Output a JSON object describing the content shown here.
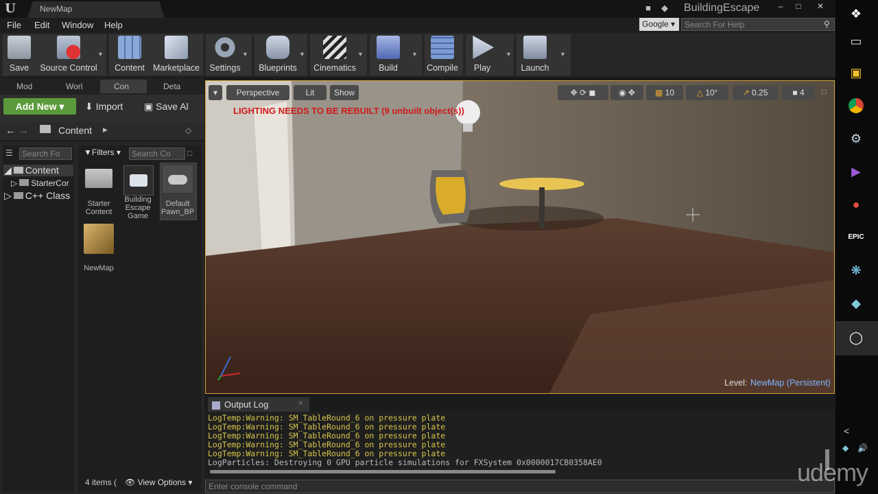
{
  "window": {
    "tab_title": "NewMap",
    "project_name": "BuildingEscape",
    "logo_glyph": "U"
  },
  "menu": [
    "File",
    "Edit",
    "Window",
    "Help"
  ],
  "search": {
    "engine": "Google",
    "placeholder": "Search For Help"
  },
  "toolbar": [
    {
      "label": "Save",
      "icon": "save-icon"
    },
    {
      "label": "Source Control",
      "icon": "source-control-icon"
    },
    {
      "label": "Content",
      "icon": "content-icon"
    },
    {
      "label": "Marketplace",
      "icon": "marketplace-icon"
    },
    {
      "label": "Settings",
      "icon": "settings-icon"
    },
    {
      "label": "Blueprints",
      "icon": "blueprints-icon"
    },
    {
      "label": "Cinematics",
      "icon": "cinematics-icon"
    },
    {
      "label": "Build",
      "icon": "build-icon"
    },
    {
      "label": "Compile",
      "icon": "compile-icon"
    },
    {
      "label": "Play",
      "icon": "play-icon"
    },
    {
      "label": "Launch",
      "icon": "launch-icon"
    }
  ],
  "panel_tabs": [
    "Mod",
    "Worl",
    "Con",
    "Deta"
  ],
  "content_browser": {
    "add_new": "Add New",
    "import": "Import",
    "save_all": "Save Al",
    "crumb": "Content",
    "tree_search": "Search Fo",
    "filters": "Filters",
    "asset_search": "Search Co",
    "tree": [
      "Content",
      "StarterCor",
      "C++ Class"
    ],
    "assets": [
      "Starter Content",
      "Building Escape Game",
      "Default Pawn_BP",
      "NewMap"
    ],
    "item_count": "4 items (",
    "view_options": "View Options"
  },
  "viewport": {
    "perspective": "Perspective",
    "lit": "Lit",
    "show": "Show",
    "warning": "LIGHTING NEEDS TO BE REBUILT (9 unbuilt object(s))",
    "grid_snap": "10",
    "rot_snap": "10°",
    "scale_snap": "0.25",
    "cam_speed": "4",
    "level_label": "Level:",
    "level_name": "NewMap (Persistent)"
  },
  "output_log": {
    "tab": "Output Log",
    "lines": [
      "LogTemp:Warning: SM_TableRound_6 on pressure plate",
      "LogTemp:Warning: SM_TableRound_6 on pressure plate",
      "LogTemp:Warning: SM_TableRound_6 on pressure plate",
      "LogTemp:Warning: SM_TableRound_6 on pressure plate",
      "LogTemp:Warning: SM_TableRound_6 on pressure plate",
      "LogParticles: Destroying 0 GPU particle simulations for FXSystem 0x0000017CB0358AE0"
    ],
    "console_placeholder": "Enter console command"
  },
  "taskbar": [
    "windows-start-icon",
    "task-view-icon",
    "file-explorer-icon",
    "chrome-icon",
    "steam-icon",
    "visual-studio-icon",
    "paint-icon",
    "epic-games-icon",
    "app-icon",
    "app-icon-2",
    "unreal-engine-icon"
  ],
  "watermark": "udemy",
  "colors": {
    "accent_green": "#5a9a3a",
    "warning_red": "#d01a1a",
    "log_warning": "#d8c64a",
    "viewport_border": "#d4a23a",
    "level_link": "#7bb4ff"
  }
}
